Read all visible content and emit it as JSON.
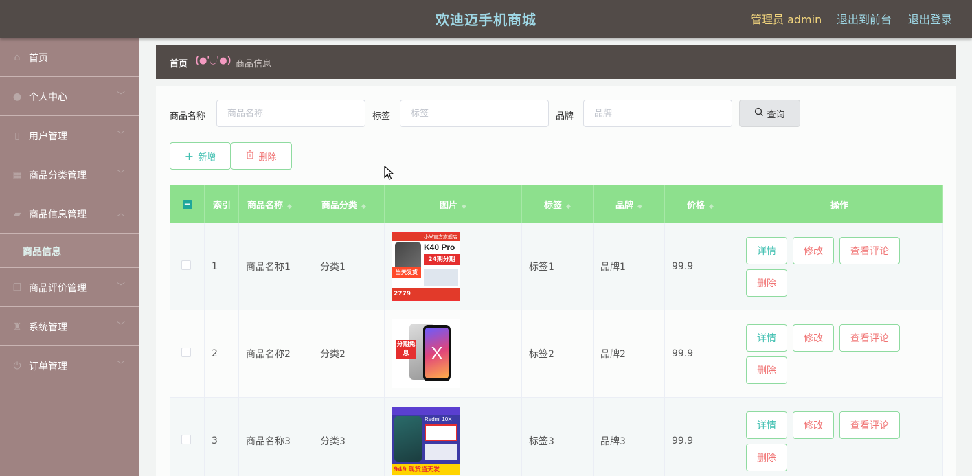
{
  "header": {
    "title": "欢迪迈手机商城",
    "admin_label": "管理员 admin",
    "front_link": "退出到前台",
    "logout_link": "退出登录"
  },
  "sidebar": {
    "items": [
      {
        "label": "首页",
        "icon": "home-icon"
      },
      {
        "label": "个人中心",
        "icon": "user-icon"
      },
      {
        "label": "用户管理",
        "icon": "mobile-icon"
      },
      {
        "label": "商品分类管理",
        "icon": "grid-icon"
      },
      {
        "label": "商品信息管理",
        "icon": "shop-icon"
      },
      {
        "label": "商品评价管理",
        "icon": "copy-icon"
      },
      {
        "label": "系统管理",
        "icon": "trophy-icon"
      },
      {
        "label": "订单管理",
        "icon": "power-icon"
      }
    ],
    "submenu_active": "商品信息"
  },
  "breadcrumb": {
    "home": "首页",
    "separator": "(●'◡'●)",
    "current": "商品信息"
  },
  "search": {
    "name_label": "商品名称",
    "name_placeholder": "商品名称",
    "tag_label": "标签",
    "tag_placeholder": "标签",
    "brand_label": "品牌",
    "brand_placeholder": "品牌",
    "query_button": "查询"
  },
  "actions": {
    "add": "新增",
    "delete": "删除"
  },
  "table": {
    "headers": {
      "index": "索引",
      "name": "商品名称",
      "category": "商品分类",
      "picture": "图片",
      "tag": "标签",
      "brand": "品牌",
      "price": "价格",
      "operations": "操作"
    },
    "rows": [
      {
        "index": "1",
        "name": "商品名称1",
        "category": "分类1",
        "tag": "标签1",
        "brand": "品牌1",
        "price": "99.9",
        "img_text": {
          "band": "小米官方旗舰店",
          "model": "K40 Pro",
          "promo": "24期分期",
          "promo2": "当天发货",
          "price": "2779"
        }
      },
      {
        "index": "2",
        "name": "商品名称2",
        "category": "分类2",
        "tag": "标签2",
        "brand": "品牌2",
        "price": "99.9",
        "img_text": {
          "tag": "分期免息",
          "letter": "X"
        }
      },
      {
        "index": "3",
        "name": "商品名称3",
        "category": "分类3",
        "tag": "标签3",
        "brand": "品牌3",
        "price": "99.9",
        "img_text": {
          "model": "Redmi 10X",
          "price": "949 现货当天发"
        }
      }
    ],
    "op_labels": {
      "detail": "详情",
      "edit": "修改",
      "review": "查看评论",
      "remove": "删除"
    }
  },
  "colors": {
    "topbar": "#524b48",
    "sidebar": "#9f8382",
    "table_header": "#8de08d",
    "accent": "#3fbfb0"
  }
}
